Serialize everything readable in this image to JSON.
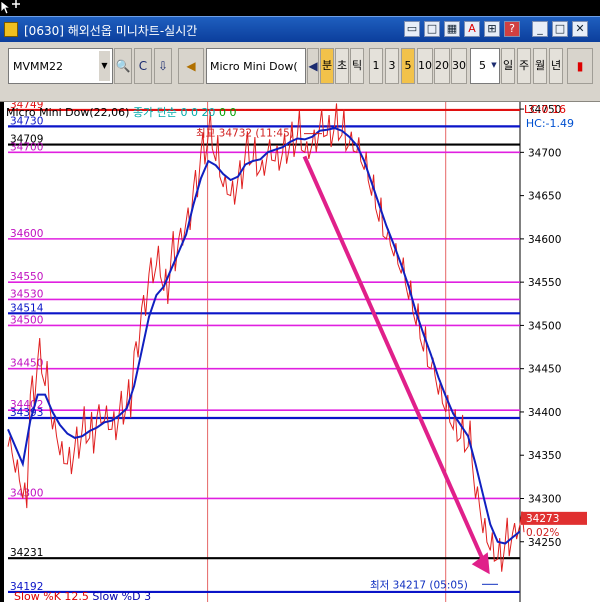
{
  "window": {
    "title": "[0630] 해외선옵 미니차트-실시간",
    "buttons": [
      "▭",
      "□",
      "▦",
      "A",
      "⊞",
      "?",
      "_",
      "□",
      "✕"
    ]
  },
  "toolbar": {
    "symbol": "MVMM22",
    "instrument_name": "Micro Mini Dow(",
    "periods": [
      {
        "label": "분",
        "active": true
      },
      {
        "label": "초",
        "active": false
      },
      {
        "label": "틱",
        "active": false
      },
      {
        "label": "1",
        "active": false
      },
      {
        "label": "3",
        "active": false
      },
      {
        "label": "5",
        "active": true
      },
      {
        "label": "10",
        "active": false
      },
      {
        "label": "20",
        "active": false
      },
      {
        "label": "30",
        "active": false
      }
    ],
    "interval_value": "5",
    "tail_periods": [
      "일",
      "주",
      "월",
      "년"
    ]
  },
  "chart_header": {
    "name": "Micro Mini Dow(22,06)",
    "indicator": "종가 단순",
    "nums": [
      "0",
      "0",
      "20",
      "0",
      "0"
    ]
  },
  "lc_label": "LC:0.16",
  "hc_label": "HC:-1.49",
  "bottom_label": {
    "k": "Slow %K 12.5",
    "d": "Slow %D 3"
  },
  "chart_data": {
    "type": "line",
    "title": "",
    "xlabel": "",
    "ylabel": "",
    "ylim": [
      34185,
      34742
    ],
    "y_ticks": [
      34750,
      34700,
      34650,
      34600,
      34550,
      34500,
      34450,
      34400,
      34350,
      34300,
      34250
    ],
    "current_price": "34273",
    "current_change": "0.02%",
    "high_annotation": "최고 34732 (11:45)",
    "low_annotation": "최저 34217 (05:05)",
    "levels": [
      {
        "label": "34730",
        "value": 34730,
        "color": "#0a14c8"
      },
      {
        "label": "34749",
        "value": 34749,
        "color": "#e01010"
      },
      {
        "label": "34709",
        "value": 34709,
        "color": "#000000"
      },
      {
        "label": "34700",
        "value": 34700,
        "color": "#e020e0"
      },
      {
        "label": "34600",
        "value": 34600,
        "color": "#e020e0"
      },
      {
        "label": "34550",
        "value": 34550,
        "color": "#e020e0"
      },
      {
        "label": "34530",
        "value": 34530,
        "color": "#e020e0"
      },
      {
        "label": "34514",
        "value": 34514,
        "color": "#0a14c8"
      },
      {
        "label": "34500",
        "value": 34500,
        "color": "#e020e0"
      },
      {
        "label": "34450",
        "value": 34450,
        "color": "#e020e0"
      },
      {
        "label": "34402",
        "value": 34402,
        "color": "#e020e0"
      },
      {
        "label": "34393",
        "value": 34393,
        "color": "#0a14c8"
      },
      {
        "label": "34300",
        "value": 34300,
        "color": "#e020e0"
      },
      {
        "label": "34231",
        "value": 34231,
        "color": "#000000"
      },
      {
        "label": "34192",
        "value": 34192,
        "color": "#0a14c8"
      }
    ],
    "price_series": [
      34360,
      34330,
      34300,
      34420,
      34460,
      34430,
      34380,
      34350,
      34340,
      34360,
      34380,
      34370,
      34395,
      34390,
      34380,
      34400,
      34410,
      34470,
      34520,
      34560,
      34570,
      34540,
      34580,
      34600,
      34620,
      34660,
      34700,
      34720,
      34690,
      34660,
      34650,
      34670,
      34700,
      34690,
      34680,
      34700,
      34690,
      34700,
      34710,
      34720,
      34700,
      34710,
      34730,
      34720,
      34730,
      34720,
      34710,
      34700,
      34680,
      34650,
      34620,
      34600,
      34580,
      34560,
      34530,
      34500,
      34470,
      34450,
      34420,
      34400,
      34380,
      34370,
      34360,
      34300,
      34260,
      34240,
      34230,
      34250,
      34260,
      34270
    ],
    "ma_series": [
      34380,
      34360,
      34340,
      34390,
      34420,
      34420,
      34400,
      34385,
      34375,
      34370,
      34372,
      34378,
      34382,
      34388,
      34390,
      34396,
      34404,
      34430,
      34470,
      34510,
      34535,
      34545,
      34565,
      34585,
      34605,
      34640,
      34670,
      34690,
      34685,
      34675,
      34668,
      34672,
      34686,
      34690,
      34692,
      34700,
      34703,
      34706,
      34712,
      34716,
      34715,
      34718,
      34725,
      34726,
      34728,
      34725,
      34718,
      34708,
      34690,
      34665,
      34640,
      34615,
      34593,
      34570,
      34545,
      34515,
      34490,
      34466,
      34440,
      34418,
      34398,
      34385,
      34372,
      34340,
      34305,
      34270,
      34250,
      34248,
      34255,
      34262
    ],
    "arrow": {
      "from_index": 44,
      "to_index": 66
    }
  }
}
